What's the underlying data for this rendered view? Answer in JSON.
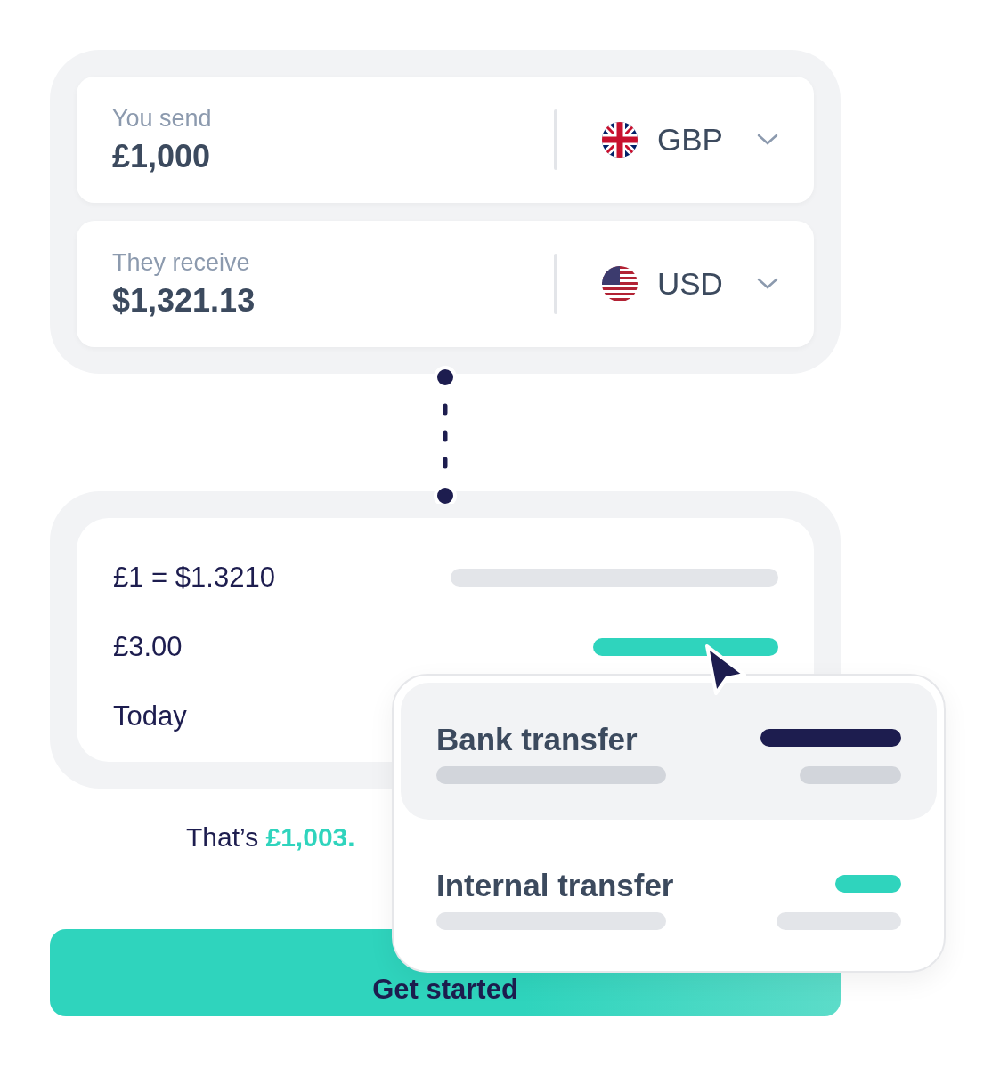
{
  "fields": [
    {
      "label": "You send",
      "value": "£1,000",
      "currency": "GBP",
      "kind": "gb"
    },
    {
      "label": "They receive",
      "value": "$1,321.13",
      "currency": "USD",
      "kind": "us"
    }
  ],
  "details": [
    {
      "text": "£1 = $1.3210",
      "kind": "neutral"
    },
    {
      "text": "£3.00",
      "kind": "accent"
    },
    {
      "text": "Today",
      "kind": "plain"
    }
  ],
  "total": {
    "prefix": "That’s",
    "amount": "£1,003."
  },
  "button": "Get started",
  "options": [
    {
      "label": "Bank transfer",
      "selected": true
    },
    {
      "label": "Internal transfer",
      "selected": false
    }
  ]
}
